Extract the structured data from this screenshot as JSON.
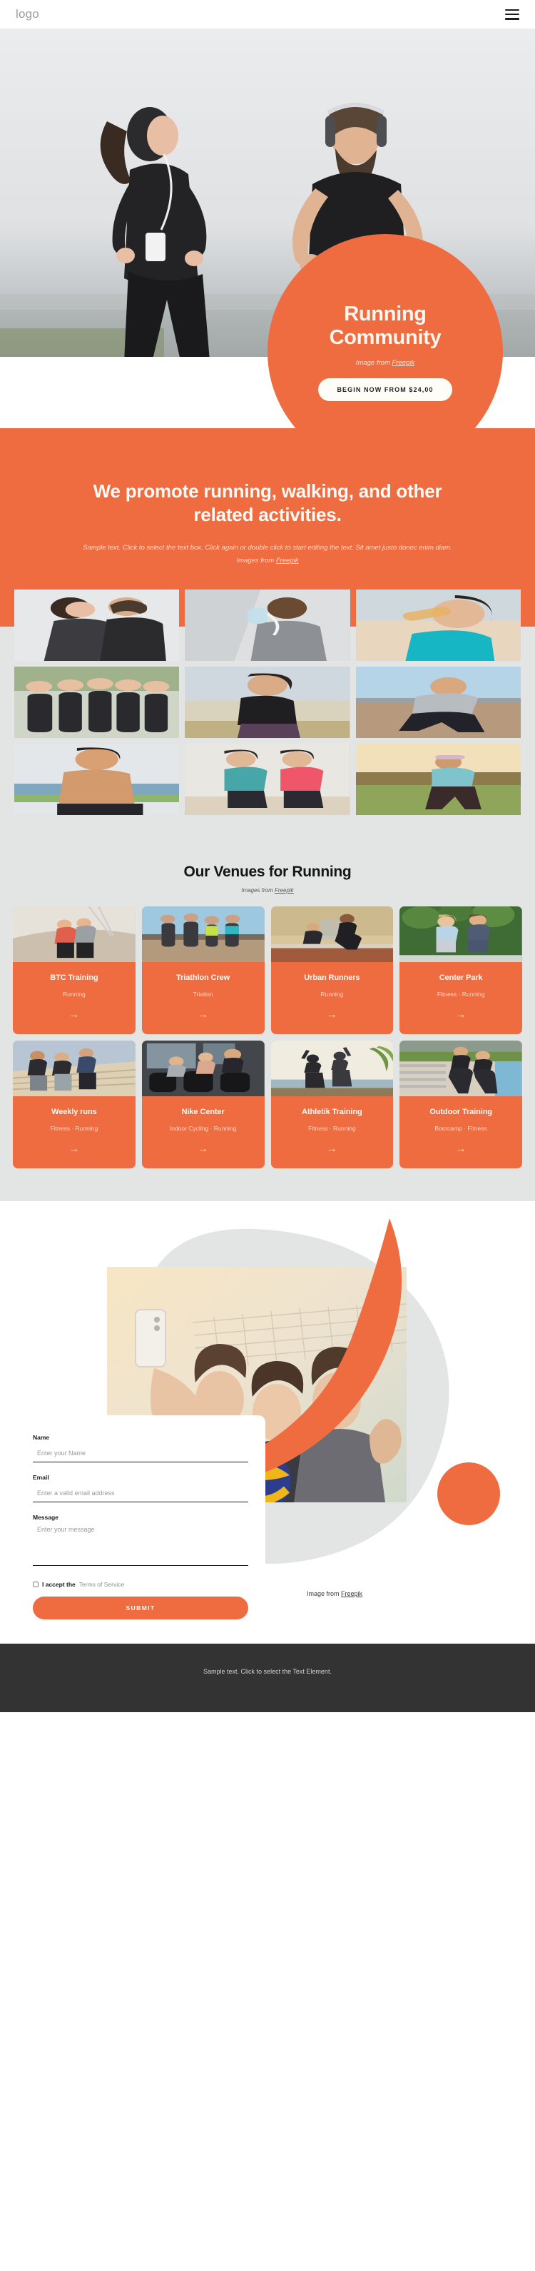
{
  "header": {
    "logo": "logo",
    "menu_icon": "hamburger-menu-icon"
  },
  "hero": {
    "title_line1": "Running",
    "title_line2": "Community",
    "credit_prefix": "Image from ",
    "credit_link": "Freepik",
    "cta_label": "BEGIN NOW FROM $24,00"
  },
  "promo": {
    "title": "We promote running, walking, and other related activities.",
    "sub_text": "Sample text. Click to select the text box. Click again or double click to start editing the text. Sit amet justo donec enim diam. Images from ",
    "sub_link": "Freepik"
  },
  "gallery": {
    "items": [
      {
        "alt": "couple-jogging-photo"
      },
      {
        "alt": "man-drinking-water-photo"
      },
      {
        "alt": "woman-drinking-water-photo"
      },
      {
        "alt": "group-hands-together-photo"
      },
      {
        "alt": "woman-running-beach-photo"
      },
      {
        "alt": "man-starting-block-photo"
      },
      {
        "alt": "shirtless-man-phone-photo"
      },
      {
        "alt": "two-women-running-beach-photo"
      },
      {
        "alt": "man-running-sunset-photo"
      }
    ]
  },
  "venues": {
    "title": "Our Venues for Running",
    "credit_prefix": "Images from ",
    "credit_link": "Freepik",
    "cards": [
      {
        "name": "BTC Training",
        "tags": "Running",
        "arrow": "→",
        "img": "bridge-runners-photo"
      },
      {
        "name": "Triathlon Crew",
        "tags": "Triatlon",
        "arrow": "→",
        "img": "four-athletes-sunset-photo"
      },
      {
        "name": "Urban Runners",
        "tags": "Running",
        "arrow": "→",
        "img": "track-sprinters-photo"
      },
      {
        "name": "Center Park",
        "tags": "Fitness · Running",
        "arrow": "→",
        "img": "park-couple-running-photo"
      },
      {
        "name": "Weekly runs",
        "tags": "Fitness · Running",
        "arrow": "→",
        "img": "stairs-group-running-photo"
      },
      {
        "name": "Nike Center",
        "tags": "Indoor Cycling · Running",
        "arrow": "→",
        "img": "spin-class-photo"
      },
      {
        "name": "Athletik Training",
        "tags": "Fitness · Running",
        "arrow": "→",
        "img": "beach-high-five-photo"
      },
      {
        "name": "Outdoor Training",
        "tags": "Bootcamp · Fitness",
        "arrow": "→",
        "img": "outdoor-stretching-photo"
      }
    ]
  },
  "contact": {
    "photo_alt": "three-women-selfie-photo",
    "fields": [
      {
        "label": "Name",
        "placeholder": "Enter your Name",
        "value": ""
      },
      {
        "label": "Email",
        "placeholder": "Enter a valid email address",
        "value": ""
      },
      {
        "label": "Message",
        "placeholder": "Enter your message",
        "value": ""
      }
    ],
    "accept_text": "I accept the",
    "accept_link": "Terms of Service",
    "submit_label": "SUBMIT",
    "credit_prefix": "Image from ",
    "credit_link": "Freepik"
  },
  "footer": {
    "text": "Sample text. Click to select the Text Element."
  },
  "colors": {
    "accent": "#ef6b40",
    "page_gray": "#e3e4e4",
    "footer_dark": "#333333",
    "text_dark": "#151515"
  }
}
